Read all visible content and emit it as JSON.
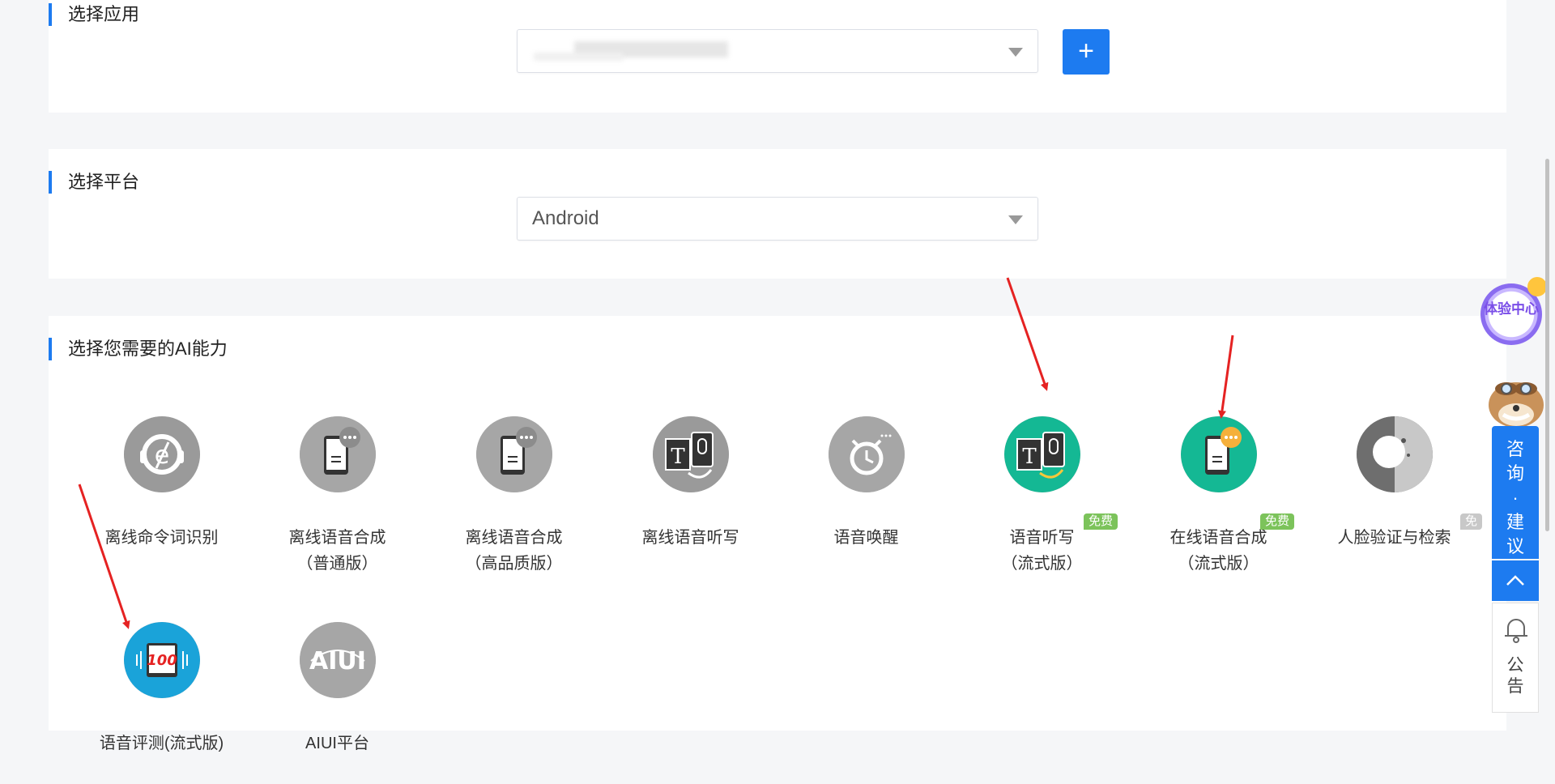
{
  "sections": {
    "app": {
      "title": "选择应用",
      "selected": "",
      "add_label": "+"
    },
    "platform": {
      "title": "选择平台",
      "selected": "Android"
    },
    "abilities": {
      "title": "选择您需要的AI能力"
    }
  },
  "capabilities": [
    {
      "name": "offline-command-recognition",
      "label": "离线命令词识别",
      "label2": "",
      "icon": "headset-mic-icon",
      "color": "#9a9a9a",
      "badge": ""
    },
    {
      "name": "offline-tts-standard",
      "label": "离线语音合成",
      "label2": "（普通版）",
      "icon": "phone-chat-icon",
      "color": "#a6a6a6",
      "badge": ""
    },
    {
      "name": "offline-tts-hq",
      "label": "离线语音合成",
      "label2": "（高品质版）",
      "icon": "phone-chat-icon",
      "color": "#a6a6a6",
      "badge": ""
    },
    {
      "name": "offline-dictation",
      "label": "离线语音听写",
      "label2": "",
      "icon": "text-mic-icon",
      "color": "#9a9a9a",
      "badge": ""
    },
    {
      "name": "voice-wakeup",
      "label": "语音唤醒",
      "label2": "",
      "icon": "alarm-clock-icon",
      "color": "#a6a6a6",
      "badge": ""
    },
    {
      "name": "dictation-streaming",
      "label": "语音听写",
      "label2": "（流式版）",
      "icon": "text-mic-icon",
      "color": "#14b894",
      "badge": "免费"
    },
    {
      "name": "online-tts-streaming",
      "label": "在线语音合成",
      "label2": "（流式版）",
      "icon": "phone-chat-icon",
      "color": "#14b894",
      "badge": "免费"
    },
    {
      "name": "face-verify",
      "label": "人脸验证与检索",
      "label2": "",
      "icon": "face-icon",
      "color": "#8a8a8a",
      "badge": "免费"
    },
    {
      "name": "speech-evaluation",
      "label": "语音评测(流式版)",
      "label2": "",
      "icon": "score-100-icon",
      "color": "#1aa3d9",
      "badge": ""
    },
    {
      "name": "aiui-platform",
      "label": "AIUI平台",
      "label2": "",
      "icon": "aiui-logo-icon",
      "color": "#a6a6a6",
      "badge": ""
    }
  ],
  "sidebar": {
    "experience_center": "体验中心",
    "consult": "咨询·建议",
    "notice": "公告"
  },
  "colors": {
    "accent": "#1d7bf0",
    "free_badge": "#7cc35b",
    "arrow": "#e52222"
  }
}
